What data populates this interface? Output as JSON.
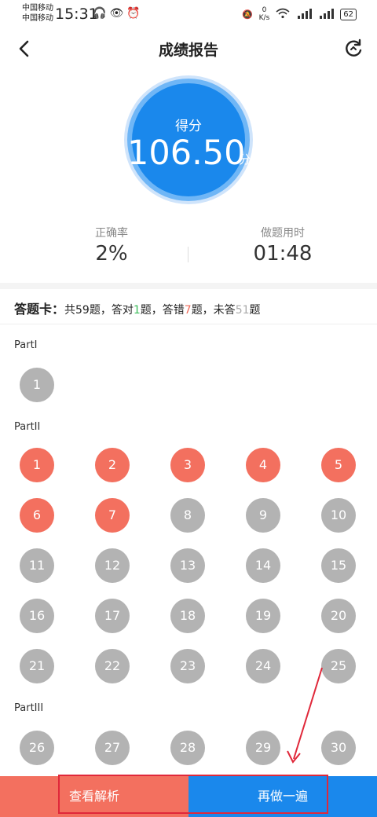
{
  "status_bar": {
    "carrier1": "中国移动",
    "carrier2": "中国移动",
    "time": "15:31",
    "net_speed_value": "0",
    "net_speed_unit": "K/s",
    "battery": "62"
  },
  "header": {
    "title": "成绩报告"
  },
  "score": {
    "label": "得分",
    "value": "106.50",
    "unit": "分"
  },
  "stats": {
    "accuracy_label": "正确率",
    "accuracy_value": "2%",
    "time_label": "做题用时",
    "time_value": "01:48"
  },
  "answer_card": {
    "title": "答题卡：",
    "p1": "共59题，答对",
    "correct": "1",
    "p2": "题，答错",
    "wrong": "7",
    "p3": "题，未答",
    "unanswered": "51",
    "p4": "题"
  },
  "parts": [
    {
      "label": "PartI",
      "questions": [
        {
          "n": "1",
          "s": "unanswered"
        }
      ]
    },
    {
      "label": "PartII",
      "questions": [
        {
          "n": "1",
          "s": "wrong"
        },
        {
          "n": "2",
          "s": "wrong"
        },
        {
          "n": "3",
          "s": "wrong"
        },
        {
          "n": "4",
          "s": "wrong"
        },
        {
          "n": "5",
          "s": "wrong"
        },
        {
          "n": "6",
          "s": "wrong"
        },
        {
          "n": "7",
          "s": "wrong"
        },
        {
          "n": "8",
          "s": "unanswered"
        },
        {
          "n": "9",
          "s": "unanswered"
        },
        {
          "n": "10",
          "s": "unanswered"
        },
        {
          "n": "11",
          "s": "unanswered"
        },
        {
          "n": "12",
          "s": "unanswered"
        },
        {
          "n": "13",
          "s": "unanswered"
        },
        {
          "n": "14",
          "s": "unanswered"
        },
        {
          "n": "15",
          "s": "unanswered"
        },
        {
          "n": "16",
          "s": "unanswered"
        },
        {
          "n": "17",
          "s": "unanswered"
        },
        {
          "n": "18",
          "s": "unanswered"
        },
        {
          "n": "19",
          "s": "unanswered"
        },
        {
          "n": "20",
          "s": "unanswered"
        },
        {
          "n": "21",
          "s": "unanswered"
        },
        {
          "n": "22",
          "s": "unanswered"
        },
        {
          "n": "23",
          "s": "unanswered"
        },
        {
          "n": "24",
          "s": "unanswered"
        },
        {
          "n": "25",
          "s": "unanswered"
        }
      ]
    },
    {
      "label": "PartIII",
      "questions": [
        {
          "n": "26",
          "s": "unanswered"
        },
        {
          "n": "27",
          "s": "unanswered"
        },
        {
          "n": "28",
          "s": "unanswered"
        },
        {
          "n": "29",
          "s": "unanswered"
        },
        {
          "n": "30",
          "s": "unanswered"
        }
      ]
    }
  ],
  "buttons": {
    "review": "查看解析",
    "redo": "再做一遍"
  },
  "colors": {
    "primary": "#1a88ec",
    "wrong": "#f3705f",
    "unanswered": "#b3b3b3",
    "correct_text": "#3cbc5a",
    "annotation": "#e0283a"
  }
}
